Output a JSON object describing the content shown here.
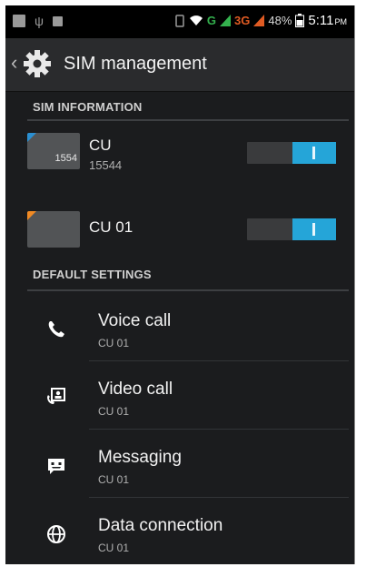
{
  "status_bar": {
    "network_g": "G",
    "network_3g": "3G",
    "battery": "48%",
    "time": "5:11",
    "ampm": "PM"
  },
  "app_bar": {
    "title": "SIM management"
  },
  "sim_info": {
    "header": "SIM INFORMATION",
    "sims": [
      {
        "name": "CU",
        "number": "15544",
        "card_label": "1554",
        "corner_color": "#2b8fd1",
        "enabled": true
      },
      {
        "name": "CU 01",
        "number": "",
        "card_label": "",
        "corner_color": "#f08a24",
        "enabled": true
      }
    ]
  },
  "default_settings": {
    "header": "DEFAULT SETTINGS",
    "items": [
      {
        "icon": "phone-icon",
        "title": "Voice call",
        "value": "CU 01"
      },
      {
        "icon": "video-call-icon",
        "title": "Video call",
        "value": "CU 01"
      },
      {
        "icon": "messaging-icon",
        "title": "Messaging",
        "value": "CU 01"
      },
      {
        "icon": "globe-icon",
        "title": "Data connection",
        "value": "CU 01"
      }
    ]
  },
  "colors": {
    "accent": "#25a5d8",
    "background": "#1b1c1e"
  }
}
